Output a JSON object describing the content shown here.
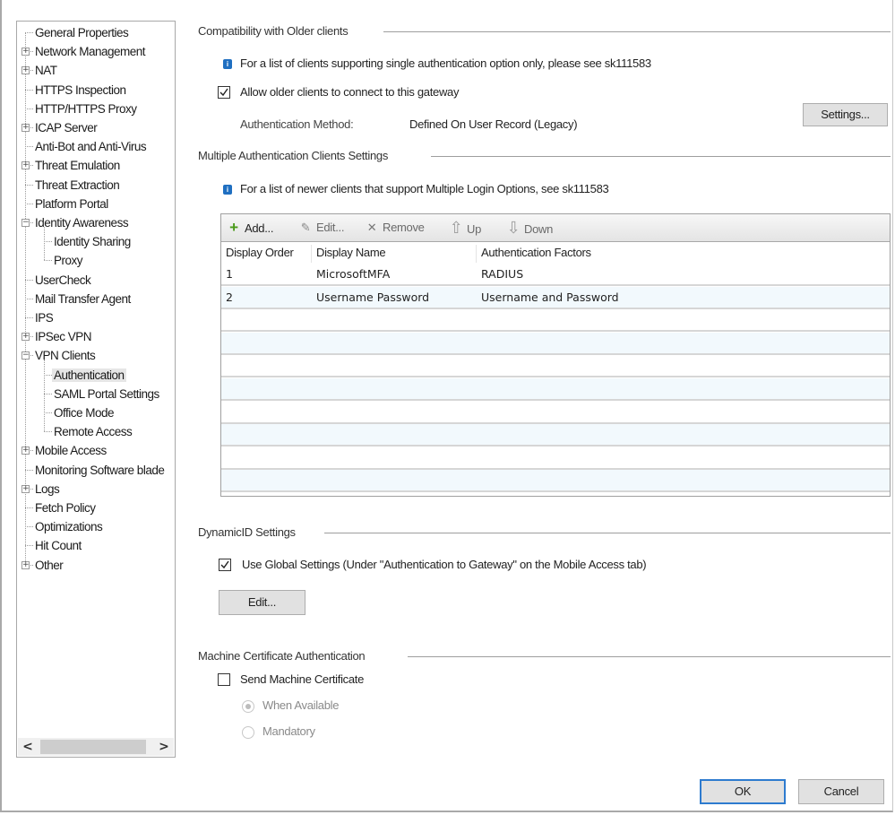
{
  "tree": {
    "items": [
      {
        "label": "General Properties",
        "level": 0,
        "expander": "none"
      },
      {
        "label": "Network Management",
        "level": 0,
        "expander": "plus"
      },
      {
        "label": "NAT",
        "level": 0,
        "expander": "plus"
      },
      {
        "label": "HTTPS Inspection",
        "level": 0,
        "expander": "none"
      },
      {
        "label": "HTTP/HTTPS Proxy",
        "level": 0,
        "expander": "none"
      },
      {
        "label": "ICAP Server",
        "level": 0,
        "expander": "plus"
      },
      {
        "label": "Anti-Bot and Anti-Virus",
        "level": 0,
        "expander": "none"
      },
      {
        "label": "Threat Emulation",
        "level": 0,
        "expander": "plus"
      },
      {
        "label": "Threat Extraction",
        "level": 0,
        "expander": "none"
      },
      {
        "label": "Platform Portal",
        "level": 0,
        "expander": "none"
      },
      {
        "label": "Identity Awareness",
        "level": 0,
        "expander": "minus"
      },
      {
        "label": "Identity Sharing",
        "level": 1,
        "expander": "none"
      },
      {
        "label": "Proxy",
        "level": 1,
        "expander": "none"
      },
      {
        "label": "UserCheck",
        "level": 0,
        "expander": "none"
      },
      {
        "label": "Mail Transfer Agent",
        "level": 0,
        "expander": "none"
      },
      {
        "label": "IPS",
        "level": 0,
        "expander": "none"
      },
      {
        "label": "IPSec VPN",
        "level": 0,
        "expander": "plus"
      },
      {
        "label": "VPN Clients",
        "level": 0,
        "expander": "minus"
      },
      {
        "label": "Authentication",
        "level": 1,
        "expander": "none",
        "selected": true
      },
      {
        "label": "SAML Portal Settings",
        "level": 1,
        "expander": "none"
      },
      {
        "label": "Office Mode",
        "level": 1,
        "expander": "none"
      },
      {
        "label": "Remote Access",
        "level": 1,
        "expander": "none"
      },
      {
        "label": "Mobile Access",
        "level": 0,
        "expander": "plus"
      },
      {
        "label": "Monitoring Software blade",
        "level": 0,
        "expander": "none"
      },
      {
        "label": "Logs",
        "level": 0,
        "expander": "plus"
      },
      {
        "label": "Fetch Policy",
        "level": 0,
        "expander": "none"
      },
      {
        "label": "Optimizations",
        "level": 0,
        "expander": "none"
      },
      {
        "label": "Hit Count",
        "level": 0,
        "expander": "none"
      },
      {
        "label": "Other",
        "level": 0,
        "expander": "plus"
      }
    ],
    "scroll_left": "<",
    "scroll_right": ">"
  },
  "compat": {
    "title": "Compatibility with Older clients",
    "info_icon": "i",
    "info_text": "For a list of clients supporting single authentication option only, please see sk111583",
    "allow_older_label": "Allow older clients to connect to this gateway",
    "allow_older_checked": true,
    "auth_method_label": "Authentication Method:",
    "auth_method_value": "Defined On User Record (Legacy)",
    "settings_button": "Settings..."
  },
  "multi": {
    "title": "Multiple Authentication Clients Settings",
    "info_icon": "i",
    "info_text": "For a list of newer clients that support Multiple Login Options, see sk111583",
    "toolbar": {
      "add": {
        "icon": "+",
        "label": "Add..."
      },
      "edit": {
        "icon": "✎",
        "label": "Edit..."
      },
      "remove": {
        "icon": "✕",
        "label": "Remove"
      },
      "up": {
        "icon": "⇧",
        "label": "Up"
      },
      "down": {
        "icon": "⇩",
        "label": "Down"
      }
    },
    "columns": [
      "Display Order",
      "Display Name",
      "Authentication Factors"
    ],
    "rows": [
      {
        "order": "1",
        "name": "MicrosoftMFA",
        "factors": "RADIUS"
      },
      {
        "order": "2",
        "name": "Username Password",
        "factors": "Username and Password"
      }
    ]
  },
  "dynamicid": {
    "title": "DynamicID Settings",
    "use_global_label": "Use Global Settings (Under \"Authentication to Gateway\" on the Mobile Access tab)",
    "use_global_checked": true,
    "edit_button": "Edit..."
  },
  "machine_cert": {
    "title": "Machine Certificate Authentication",
    "send_label": "Send Machine Certificate",
    "send_checked": false,
    "options": [
      {
        "label": "When Available",
        "selected": true
      },
      {
        "label": "Mandatory",
        "selected": false
      }
    ]
  },
  "footer": {
    "ok_button": "OK",
    "cancel_button": "Cancel"
  }
}
